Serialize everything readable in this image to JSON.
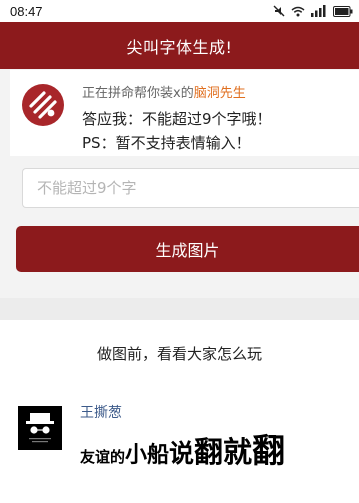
{
  "status_bar": {
    "time": "08:47",
    "icons": [
      "mute-icon",
      "wifi-icon",
      "signal-icon",
      "battery-icon"
    ]
  },
  "header": {
    "title": "尖叫字体生成!"
  },
  "info": {
    "logo_icon": "app-logo-icon",
    "line1_prefix": "正在拼命帮你装x的",
    "line1_highlight": "脑洞先生",
    "line2": "答应我：不能超过9个字哦！",
    "line3": "PS：暂不支持表情输入！"
  },
  "input": {
    "placeholder": "不能超过9个字",
    "value": ""
  },
  "button": {
    "label": "生成图片"
  },
  "examples": {
    "title": "做图前，看看大家怎么玩",
    "items": [
      {
        "username": "王撕葱",
        "avatar_icon": "user-avatar-icon",
        "words": [
          "友谊的",
          "小船",
          "说",
          "翻就",
          "翻"
        ]
      }
    ]
  },
  "colors": {
    "brand": "#8c1a1c",
    "highlight": "#e06f1f",
    "username": "#3c5a8a"
  }
}
